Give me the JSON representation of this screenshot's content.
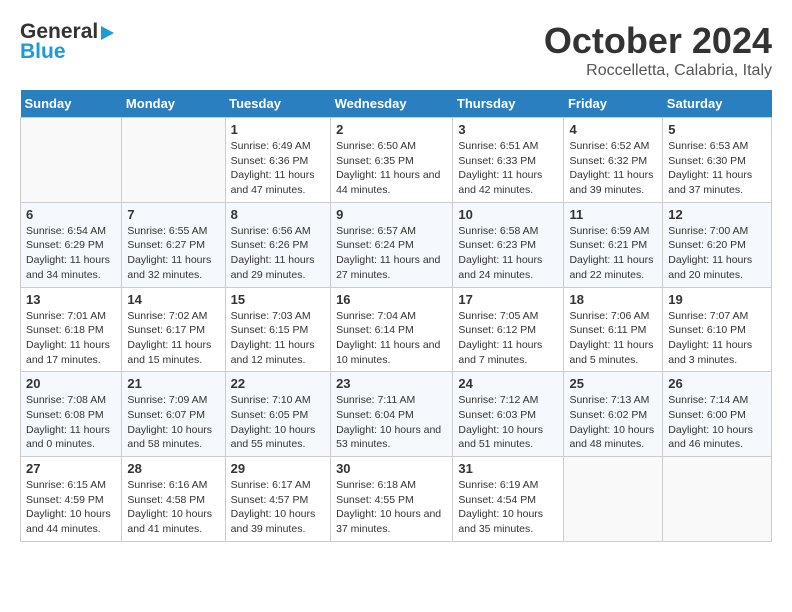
{
  "header": {
    "logo_line1": "General",
    "logo_line2": "Blue",
    "month": "October 2024",
    "location": "Roccelletta, Calabria, Italy"
  },
  "days_of_week": [
    "Sunday",
    "Monday",
    "Tuesday",
    "Wednesday",
    "Thursday",
    "Friday",
    "Saturday"
  ],
  "weeks": [
    [
      {
        "day": "",
        "info": ""
      },
      {
        "day": "",
        "info": ""
      },
      {
        "day": "1",
        "info": "Sunrise: 6:49 AM\nSunset: 6:36 PM\nDaylight: 11 hours and 47 minutes."
      },
      {
        "day": "2",
        "info": "Sunrise: 6:50 AM\nSunset: 6:35 PM\nDaylight: 11 hours and 44 minutes."
      },
      {
        "day": "3",
        "info": "Sunrise: 6:51 AM\nSunset: 6:33 PM\nDaylight: 11 hours and 42 minutes."
      },
      {
        "day": "4",
        "info": "Sunrise: 6:52 AM\nSunset: 6:32 PM\nDaylight: 11 hours and 39 minutes."
      },
      {
        "day": "5",
        "info": "Sunrise: 6:53 AM\nSunset: 6:30 PM\nDaylight: 11 hours and 37 minutes."
      }
    ],
    [
      {
        "day": "6",
        "info": "Sunrise: 6:54 AM\nSunset: 6:29 PM\nDaylight: 11 hours and 34 minutes."
      },
      {
        "day": "7",
        "info": "Sunrise: 6:55 AM\nSunset: 6:27 PM\nDaylight: 11 hours and 32 minutes."
      },
      {
        "day": "8",
        "info": "Sunrise: 6:56 AM\nSunset: 6:26 PM\nDaylight: 11 hours and 29 minutes."
      },
      {
        "day": "9",
        "info": "Sunrise: 6:57 AM\nSunset: 6:24 PM\nDaylight: 11 hours and 27 minutes."
      },
      {
        "day": "10",
        "info": "Sunrise: 6:58 AM\nSunset: 6:23 PM\nDaylight: 11 hours and 24 minutes."
      },
      {
        "day": "11",
        "info": "Sunrise: 6:59 AM\nSunset: 6:21 PM\nDaylight: 11 hours and 22 minutes."
      },
      {
        "day": "12",
        "info": "Sunrise: 7:00 AM\nSunset: 6:20 PM\nDaylight: 11 hours and 20 minutes."
      }
    ],
    [
      {
        "day": "13",
        "info": "Sunrise: 7:01 AM\nSunset: 6:18 PM\nDaylight: 11 hours and 17 minutes."
      },
      {
        "day": "14",
        "info": "Sunrise: 7:02 AM\nSunset: 6:17 PM\nDaylight: 11 hours and 15 minutes."
      },
      {
        "day": "15",
        "info": "Sunrise: 7:03 AM\nSunset: 6:15 PM\nDaylight: 11 hours and 12 minutes."
      },
      {
        "day": "16",
        "info": "Sunrise: 7:04 AM\nSunset: 6:14 PM\nDaylight: 11 hours and 10 minutes."
      },
      {
        "day": "17",
        "info": "Sunrise: 7:05 AM\nSunset: 6:12 PM\nDaylight: 11 hours and 7 minutes."
      },
      {
        "day": "18",
        "info": "Sunrise: 7:06 AM\nSunset: 6:11 PM\nDaylight: 11 hours and 5 minutes."
      },
      {
        "day": "19",
        "info": "Sunrise: 7:07 AM\nSunset: 6:10 PM\nDaylight: 11 hours and 3 minutes."
      }
    ],
    [
      {
        "day": "20",
        "info": "Sunrise: 7:08 AM\nSunset: 6:08 PM\nDaylight: 11 hours and 0 minutes."
      },
      {
        "day": "21",
        "info": "Sunrise: 7:09 AM\nSunset: 6:07 PM\nDaylight: 10 hours and 58 minutes."
      },
      {
        "day": "22",
        "info": "Sunrise: 7:10 AM\nSunset: 6:05 PM\nDaylight: 10 hours and 55 minutes."
      },
      {
        "day": "23",
        "info": "Sunrise: 7:11 AM\nSunset: 6:04 PM\nDaylight: 10 hours and 53 minutes."
      },
      {
        "day": "24",
        "info": "Sunrise: 7:12 AM\nSunset: 6:03 PM\nDaylight: 10 hours and 51 minutes."
      },
      {
        "day": "25",
        "info": "Sunrise: 7:13 AM\nSunset: 6:02 PM\nDaylight: 10 hours and 48 minutes."
      },
      {
        "day": "26",
        "info": "Sunrise: 7:14 AM\nSunset: 6:00 PM\nDaylight: 10 hours and 46 minutes."
      }
    ],
    [
      {
        "day": "27",
        "info": "Sunrise: 6:15 AM\nSunset: 4:59 PM\nDaylight: 10 hours and 44 minutes."
      },
      {
        "day": "28",
        "info": "Sunrise: 6:16 AM\nSunset: 4:58 PM\nDaylight: 10 hours and 41 minutes."
      },
      {
        "day": "29",
        "info": "Sunrise: 6:17 AM\nSunset: 4:57 PM\nDaylight: 10 hours and 39 minutes."
      },
      {
        "day": "30",
        "info": "Sunrise: 6:18 AM\nSunset: 4:55 PM\nDaylight: 10 hours and 37 minutes."
      },
      {
        "day": "31",
        "info": "Sunrise: 6:19 AM\nSunset: 4:54 PM\nDaylight: 10 hours and 35 minutes."
      },
      {
        "day": "",
        "info": ""
      },
      {
        "day": "",
        "info": ""
      }
    ]
  ]
}
